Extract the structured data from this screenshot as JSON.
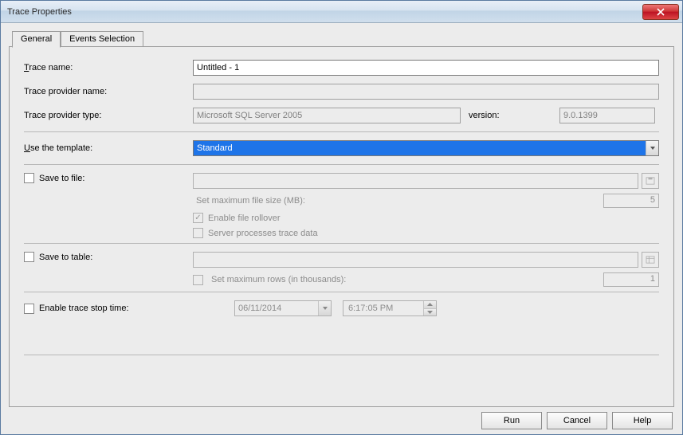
{
  "window": {
    "title": "Trace Properties"
  },
  "tabs": {
    "general": "General",
    "events": "Events Selection"
  },
  "labels": {
    "trace_name": "Trace name:",
    "provider_name": "Trace provider name:",
    "provider_type": "Trace provider type:",
    "version": "version:",
    "use_template": "Use the template:",
    "save_to_file": "Save to file:",
    "max_file_size": "Set maximum file size (MB):",
    "enable_rollover": "Enable file rollover",
    "server_processes": "Server processes trace data",
    "save_to_table": "Save to table:",
    "max_rows": "Set maximum rows (in thousands):",
    "enable_stop": "Enable trace stop time:"
  },
  "values": {
    "trace_name": "Untitled - 1",
    "provider_name": "",
    "provider_type": "Microsoft SQL Server 2005",
    "version": "9.0.1399",
    "template": "Standard",
    "max_file_size": "5",
    "max_rows": "1",
    "stop_date": "06/11/2014",
    "stop_time": "6:17:05 PM"
  },
  "buttons": {
    "run": "Run",
    "cancel": "Cancel",
    "help": "Help"
  },
  "underlines": {
    "trace_name_u": "T",
    "trace_name_rest": "race name:",
    "use_template_u": "U",
    "use_template_rest": "se the template:",
    "save_file_u": "S",
    "save_file_rest": "ave to file:",
    "enable_rollover_u": "E",
    "enable_rollover_rest": "nable file rollover",
    "server_u": "v",
    "server_pre": "Ser",
    "server_rest": "er processes trace data",
    "max_rows_u": "r",
    "max_rows_pre": "Set maximum ",
    "max_rows_rest": "ows (in thousands):",
    "stop_u": "o",
    "stop_pre": "Enable trace st",
    "stop_rest": "p time:"
  }
}
